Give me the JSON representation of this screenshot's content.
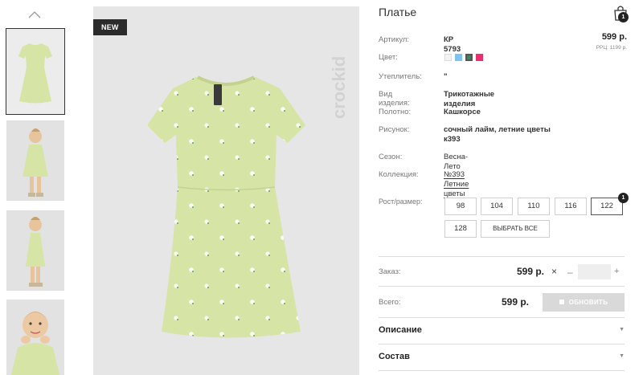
{
  "product": {
    "title": "Платье",
    "badge": "NEW",
    "brand": "crockid",
    "cart_count": "1",
    "price": "599 р.",
    "ppc": "РРЦ: 1199 р."
  },
  "attributes": [
    {
      "label": "Артикул:",
      "value": "КР 5793"
    },
    {
      "label": "Цвет:",
      "value": ""
    },
    {
      "label": "Утеплитель:",
      "value": "\""
    },
    {
      "label": "Вид изделия:",
      "value": "Трикотажные изделия"
    },
    {
      "label": "Полотно:",
      "value": "Кашкорсе"
    },
    {
      "label": "Рисунок:",
      "value": "сочный лайм, летние цветы",
      "value2": "к393"
    },
    {
      "label": "Сезон:",
      "value": "Весна-Лето"
    },
    {
      "label": "Коллекция:",
      "value": "№393 Летние цветы"
    }
  ],
  "colors": [
    {
      "name": "white",
      "hex": "#f4f4f4"
    },
    {
      "name": "light-blue",
      "hex": "#7ec4ee"
    },
    {
      "name": "green",
      "hex": "#2f8c57",
      "selected": true
    },
    {
      "name": "pink",
      "hex": "#e8306f"
    }
  ],
  "sizes": {
    "label": "Рост/размер:",
    "options": [
      "98",
      "104",
      "110",
      "116",
      "122",
      "128"
    ],
    "select_all": "ВЫБРАТЬ ВСЕ",
    "selected": "122",
    "selected_count": "1"
  },
  "order": {
    "label": "Заказ:",
    "price": "599 р.",
    "remove_icon": "×",
    "minus": "–",
    "plus": "+",
    "qty": ""
  },
  "total": {
    "label": "Всего:",
    "price": "599 р.",
    "refresh_label": "ОБНОВИТЬ"
  },
  "accordion": [
    {
      "title": "Описание"
    },
    {
      "title": "Состав"
    }
  ],
  "theme": {
    "dress_color": "#d6e4a6",
    "photo_bg": "#e6e6e6",
    "accent_dark": "#2b2b2b"
  }
}
